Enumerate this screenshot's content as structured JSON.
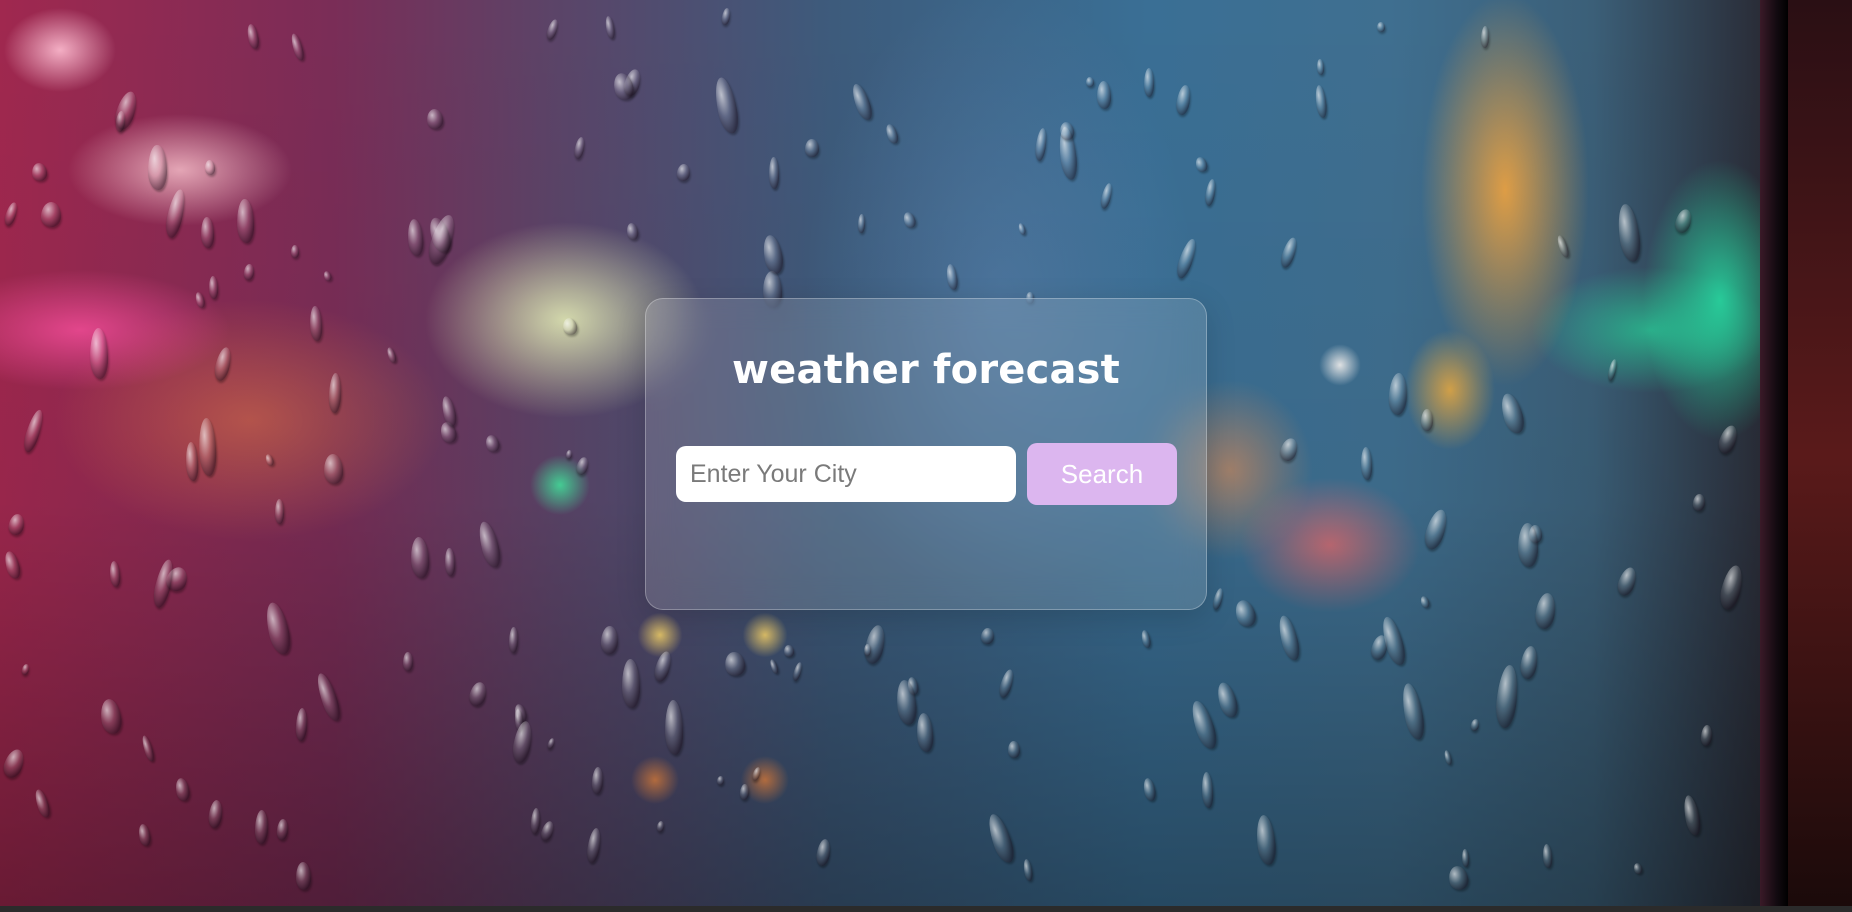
{
  "app": {
    "title": "weather forecast"
  },
  "search": {
    "placeholder": "Enter Your City",
    "value": "",
    "button_label": "Search"
  },
  "colors": {
    "button_bg": "#dcb6ef",
    "button_text": "#ffffff",
    "title_text": "#ffffff",
    "input_bg": "#ffffff"
  },
  "background": {
    "description_icon": "rainy-city-background"
  }
}
